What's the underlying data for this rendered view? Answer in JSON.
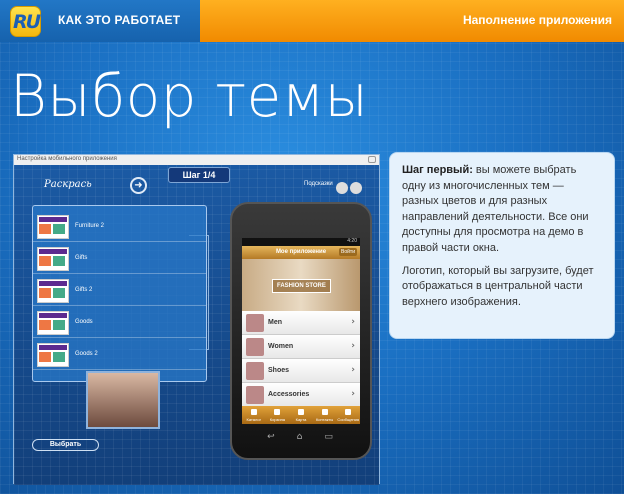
{
  "header": {
    "logo_text": "RU",
    "how_it_works": "КАК ЭТО РАБОТАЕТ",
    "section": "Наполнение приложения"
  },
  "page_title": "Выбор темы",
  "app_window": {
    "title": "Настройка мобильного приложения",
    "step": "Шаг 1/4",
    "color_label": "Раскрась",
    "hint_label": "Подсказки",
    "themes": [
      "Furniture 2",
      "Gifts",
      "Gifts 2",
      "Goods",
      "Goods 2"
    ],
    "choose_button": "Выбрать"
  },
  "phone": {
    "status": "4:20",
    "app_title": "Мое приложение",
    "top_button": "Войти",
    "banner": "FASHION STORE",
    "categories": [
      "Men",
      "Women",
      "Shoes",
      "Accessories"
    ],
    "tabs": [
      "Каталог",
      "Корзина",
      "Карта",
      "Контакты",
      "Сообщения"
    ]
  },
  "info": {
    "step_bold": "Шаг первый:",
    "step_text": " вы можете выбрать одну из многочисленных тем — разных цветов и для разных направлений деятельности. Все они доступны для просмотра на демо в правой части окна.",
    "logo_text": "Логотип, который вы загрузите, будет отображаться в центральной части верхнего изображения."
  },
  "colors": {
    "accent_orange": "#f18a00",
    "brand_blue": "#1a6bb8",
    "logo_yellow": "#ffd22e"
  }
}
